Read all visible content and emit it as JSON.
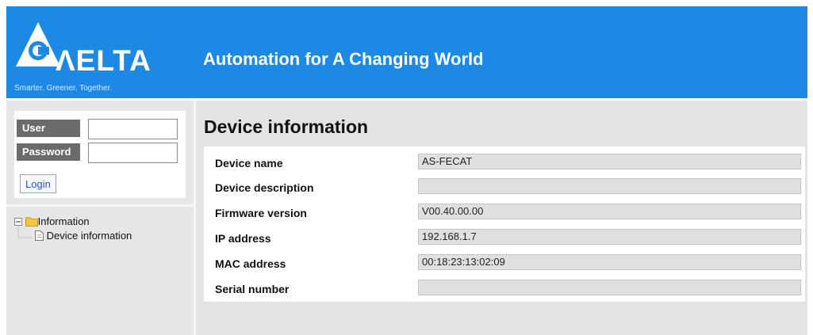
{
  "brand": {
    "logo_text": "ΛELTA",
    "slogan": "Smarter. Greener. Together.",
    "tagline": "Automation for A Changing World",
    "header_color": "#1e88e5"
  },
  "login": {
    "user_label": "User",
    "password_label": "Password",
    "user_value": "",
    "password_value": "",
    "login_button": "Login"
  },
  "tree": {
    "root": {
      "label": "Information",
      "icon": "folder-icon",
      "expander": "minus-icon"
    },
    "child": {
      "label": "Device information",
      "icon": "page-icon"
    }
  },
  "main": {
    "title": "Device information",
    "rows": [
      {
        "label": "Device name",
        "value": "AS-FECAT"
      },
      {
        "label": "Device description",
        "value": ""
      },
      {
        "label": "Firmware version",
        "value": "V00.40.00.00"
      },
      {
        "label": "IP address",
        "value": "192.168.1.7"
      },
      {
        "label": "MAC address",
        "value": "00:18:23:13:02:09"
      },
      {
        "label": "Serial number",
        "value": ""
      }
    ]
  }
}
